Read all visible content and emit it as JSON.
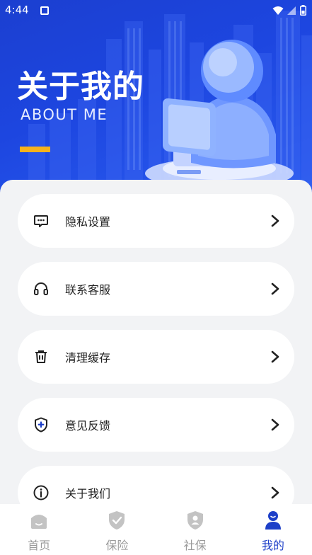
{
  "status_bar": {
    "time": "4:44"
  },
  "hero": {
    "title": "关于我的",
    "subtitle": "ABOUT ME"
  },
  "menu": [
    {
      "label": "隐私设置",
      "icon": "message-dots-icon"
    },
    {
      "label": "联系客服",
      "icon": "headset-icon"
    },
    {
      "label": "清理缓存",
      "icon": "trash-icon"
    },
    {
      "label": "意见反馈",
      "icon": "shield-plus-icon"
    },
    {
      "label": "关于我们",
      "icon": "info-circle-icon"
    }
  ],
  "tabs": [
    {
      "label": "首页",
      "icon": "home-icon",
      "active": false
    },
    {
      "label": "保险",
      "icon": "shield-check-icon",
      "active": false
    },
    {
      "label": "社保",
      "icon": "shield-person-icon",
      "active": false
    },
    {
      "label": "我的",
      "icon": "user-icon",
      "active": true
    }
  ],
  "colors": {
    "brand": "#1d3fc8",
    "accent": "#f7b21b",
    "inactive": "#9a9a9a",
    "background": "#f2f3f5"
  }
}
